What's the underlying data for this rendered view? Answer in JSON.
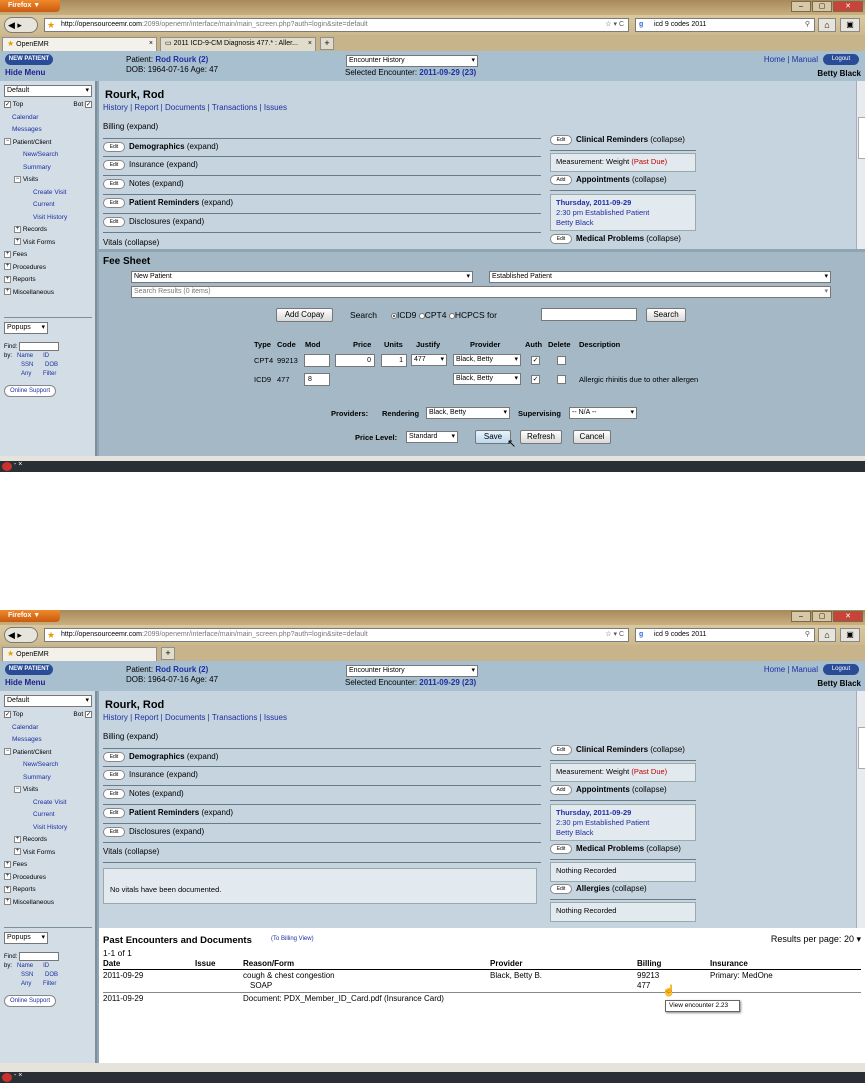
{
  "browser": {
    "menu_label": "Firefox ▼",
    "url_host": "http://opensourceemr.com",
    "url_rest_1": ":2099/openemr/interface/main/main_screen.php?auth=login&site=default",
    "url_rest_2": ":2099/openemr/interface/main/main_screen.php?auth=login&site=default",
    "search_text": "icd 9 codes 2011",
    "tabs": [
      {
        "label": "OpenEMR"
      },
      {
        "label": "2011 ICD-9-CM Diagnosis 477.* : Aller..."
      }
    ],
    "window_buttons": [
      "–",
      "▢",
      "✕"
    ]
  },
  "header": {
    "new_patient": "NEW PATIENT",
    "hide_menu": "Hide Menu",
    "patient_label": "Patient:",
    "patient_name": "Rod Rourk (2)",
    "dob_line": "DOB: 1964-07-16 Age: 47",
    "encounter_select": "Encounter History",
    "selected_enc_label": "Selected Encounter:",
    "selected_enc": "2011-09-29 (23)",
    "home": "Home",
    "manual": "Manual",
    "logout": "Logout",
    "user": "Betty Black"
  },
  "sidebar": {
    "select": "Default",
    "top": "Top",
    "bot": "Bot",
    "items": [
      {
        "label": "Calendar"
      },
      {
        "label": "Messages"
      },
      {
        "label": "Patient/Client"
      },
      {
        "label": "New/Search"
      },
      {
        "label": "Summary"
      },
      {
        "label": "Visits"
      },
      {
        "label": "Create Visit"
      },
      {
        "label": "Current"
      },
      {
        "label": "Visit History"
      },
      {
        "label": "Records"
      },
      {
        "label": "Visit Forms"
      },
      {
        "label": "Fees"
      },
      {
        "label": "Procedures"
      },
      {
        "label": "Reports"
      },
      {
        "label": "Miscellaneous"
      }
    ],
    "popups": "Popups",
    "find": "Find:",
    "by": "by:",
    "find_links": [
      "Name",
      "ID",
      "SSN",
      "DOB",
      "Any",
      "Filter"
    ],
    "online_support": "Online Support"
  },
  "summary": {
    "name": "Rourk, Rod",
    "links": [
      "History",
      "Report",
      "Documents",
      "Transactions",
      "Issues"
    ],
    "billing": "Billing",
    "expand": "(expand)",
    "collapse": "(collapse)",
    "edit": "Edit",
    "add": "Add",
    "sections": [
      {
        "title": "Demographics"
      },
      {
        "title": "Insurance"
      },
      {
        "title": "Notes"
      },
      {
        "title": "Patient Reminders"
      },
      {
        "title": "Disclosures"
      }
    ],
    "vitals": "Vitals",
    "no_vitals": "No vitals have been documented.",
    "clinical_reminders": "Clinical Reminders",
    "measurement": "Measurement: Weight",
    "past_due": "(Past Due)",
    "appointments": "Appointments",
    "appt_date": "Thursday, 2011-09-29",
    "appt_time": "2:30 pm Established Patient",
    "appt_provider": "Betty Black",
    "medical_problems": "Medical Problems",
    "nothing_recorded": "Nothing Recorded",
    "allergies": "Allergies"
  },
  "fee_sheet": {
    "title": "Fee Sheet",
    "select_new": "New Patient",
    "select_est": "Established Patient",
    "search_results": "Search Results (0 items)",
    "add_copay": "Add Copay",
    "search_label": "Search",
    "icd9": "ICD9",
    "cpt4": "CPT4",
    "hcpcs": "HCPCS",
    "for": "for",
    "search_btn": "Search",
    "cols": [
      "Type",
      "Code",
      "Mod",
      "Price",
      "Units",
      "Justify",
      "Provider",
      "Auth",
      "Delete",
      "Description"
    ],
    "row1": {
      "type": "CPT4",
      "code": "99213",
      "price": "0",
      "units": "1",
      "justify": "477",
      "provider": "Black, Betty",
      "auth_check": "✓"
    },
    "row2": {
      "type": "ICD9",
      "code": "477",
      "mod": "8",
      "provider": "Black, Betty",
      "auth_check": "✓",
      "desc": "Allergic rhinitis due to other allergen"
    },
    "providers": "Providers:",
    "rendering": "Rendering",
    "rendering_val": "Black, Betty",
    "supervising": "Supervising",
    "supervising_val": "-- N/A --",
    "price_level": "Price Level:",
    "price_level_val": "Standard",
    "save": "Save",
    "refresh": "Refresh",
    "cancel": "Cancel"
  },
  "past": {
    "title": "Past Encounters and Documents",
    "billing_view": "(To Billing View)",
    "results_label": "Results per page:",
    "results_val": "20",
    "count": "1-1 of 1",
    "cols": [
      "Date",
      "Issue",
      "Reason/Form",
      "Provider",
      "Billing",
      "Insurance"
    ],
    "rows": [
      {
        "date": "2011-09-29",
        "reason": "cough & chest congestion",
        "form": "SOAP",
        "provider": "Black, Betty B.",
        "billing1": "99213",
        "billing2": "477",
        "insurance": "Primary: MedOne"
      },
      {
        "date": "2011-09-29",
        "reason": "Document: PDX_Member_ID_Card.pdf (Insurance Card)"
      }
    ],
    "tooltip": "View encounter 2.23"
  },
  "colors": {
    "link": "#1e2fa0",
    "panel": "#c6d4df",
    "header": "#a8bfd0",
    "past_due": "#b00000"
  }
}
